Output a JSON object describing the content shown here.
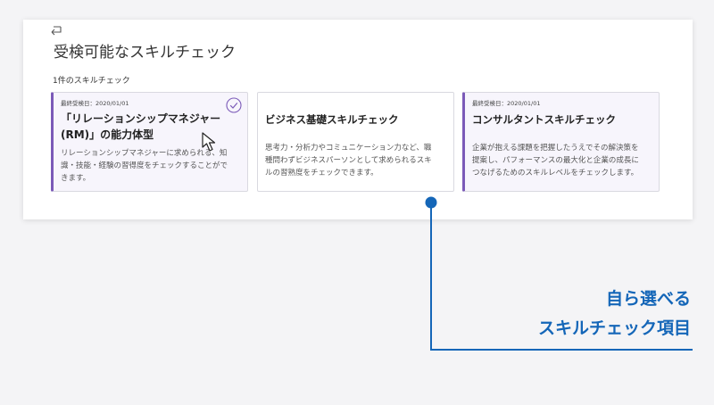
{
  "screen": {
    "title": "受検可能なスキルチェック",
    "count_label": "1件のスキルチェック"
  },
  "cards": [
    {
      "date": "最終受検日：2020/01/01",
      "title_line1": "「リレーションシップマネジャー",
      "title_line2": "(RM)」の能力体型",
      "desc_line1": "リレーションシップマネジャーに求められる、知",
      "desc_line2": "識・技能・経験の習得度をチェックすることがで",
      "desc_line3": "きます。",
      "selected": true
    },
    {
      "title": "ビジネス基礎スキルチェック",
      "desc_line1": "思考力・分析力やコミュニケーション力など、職",
      "desc_line2": "種問わずビジネスパーソンとして求められるスキ",
      "desc_line3": "ルの習熟度をチェックできます。"
    },
    {
      "date": "最終受検日：2020/01/01",
      "title": "コンサルタントスキルチェック",
      "desc_line1": "企業が抱える課題を把握したうえでその解決策を",
      "desc_line2": "提案し、パフォーマンスの最大化と企業の成長に",
      "desc_line3": "つなげるためのスキルレベルをチェックします。"
    }
  ],
  "callout": {
    "line1": "自ら選べる",
    "line2": "スキルチェック項目"
  },
  "colors": {
    "accent_purple": "#7b5ab8",
    "callout_blue": "#1466b8",
    "page_bg": "#f4f4f6"
  },
  "icons": [
    "back-icon",
    "check-icon",
    "cursor-icon"
  ]
}
